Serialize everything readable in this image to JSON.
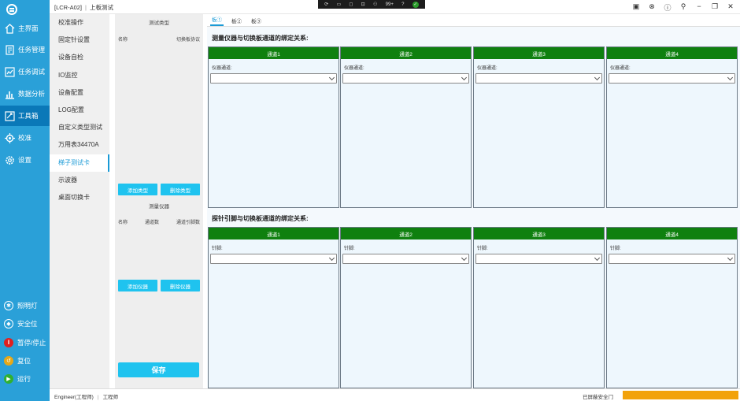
{
  "app": {
    "title": "[LCR-A02]",
    "subtitle": "上板测试"
  },
  "taskbar": {
    "icons": [
      "sync-icon",
      "window-icon",
      "chat-icon",
      "monitor-icon",
      "user-icon"
    ],
    "badge": "99+",
    "help": "?",
    "ok": "✓"
  },
  "nav": {
    "items": [
      {
        "label": "主界面",
        "icon": "home-icon"
      },
      {
        "label": "任务管理",
        "icon": "task-icon"
      },
      {
        "label": "任务调试",
        "icon": "debug-icon"
      },
      {
        "label": "数据分析",
        "icon": "chart-icon"
      },
      {
        "label": "工具箱",
        "icon": "toolbox-icon"
      },
      {
        "label": "校准",
        "icon": "calibrate-icon"
      },
      {
        "label": "设置",
        "icon": "gear-icon"
      }
    ],
    "bottom": [
      {
        "label": "照明灯",
        "icon": "light-icon",
        "color": "#2aa0d8"
      },
      {
        "label": "安全位",
        "icon": "shield-icon",
        "color": "#2aa0d8"
      },
      {
        "label": "暂停/停止",
        "icon": "stop-icon",
        "color": "#e02020"
      },
      {
        "label": "复位",
        "icon": "reset-icon",
        "color": "#e6a817"
      },
      {
        "label": "运行",
        "icon": "run-icon",
        "color": "#30b030"
      }
    ]
  },
  "subnav": {
    "items": [
      "校准操作",
      "固定针设置",
      "设备自检",
      "IO监控",
      "设备配置",
      "LOG配置",
      "自定义类型测试",
      "万用表34470A",
      "梯子测试卡",
      "示波器",
      "桌面切换卡"
    ],
    "active_index": 8
  },
  "types_panel": {
    "title": "测试类型",
    "col1": "名称",
    "col2": "切换板协议",
    "add_type": "添加类型",
    "del_type": "删除类型",
    "instrument_title": "测量仪器",
    "icol1": "名称",
    "icol2": "通道数",
    "icol3": "通道引脚数",
    "add_instrument": "添加仪器",
    "del_instrument": "删除仪器",
    "save": "保存"
  },
  "main": {
    "tabs": [
      "板①",
      "板②",
      "板③"
    ],
    "section1_title": "测量仪器与切换板通道的绑定关系:",
    "section2_title": "探针引脚与切换板通道的绑定关系:",
    "channels": [
      "通道1",
      "通道2",
      "通道3",
      "通道4"
    ],
    "section1_label": "仪器通道:",
    "section2_label": "针脚:"
  },
  "status": {
    "user": "Engineer(工程师)",
    "role": "工程师",
    "safe_text": "已屏蔽安全门",
    "bar_color": "#f2a20b"
  }
}
